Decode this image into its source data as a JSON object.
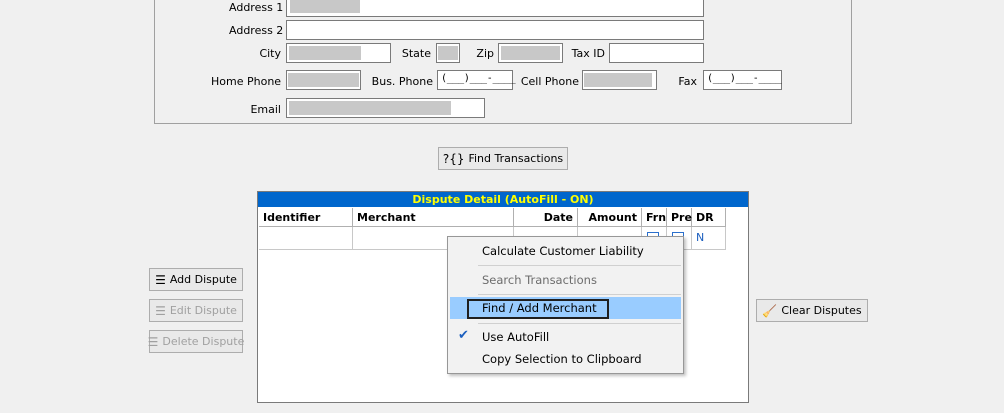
{
  "form": {
    "address1_label": "Address 1",
    "address2_label": "Address 2",
    "city_label": "City",
    "state_label": "State",
    "zip_label": "Zip",
    "taxid_label": "Tax ID",
    "homephone_label": "Home Phone",
    "busphone_label": "Bus. Phone",
    "busphone_value": "(___)___-____",
    "cellphone_label": "Cell Phone",
    "fax_label": "Fax",
    "fax_value": "(___)___-____",
    "email_label": "Email"
  },
  "find_transactions_button": "Find Transactions",
  "buttons": {
    "add_dispute": "Add Dispute",
    "edit_dispute": "Edit Dispute",
    "delete_dispute": "Delete Dispute",
    "clear_disputes": "Clear Disputes"
  },
  "grid": {
    "title": "Dispute Detail (AutoFill - ON)",
    "columns": [
      "Identifier",
      "Merchant",
      "Date",
      "Amount",
      "Frn",
      "Pre",
      "DR"
    ],
    "row": {
      "dr": "N"
    }
  },
  "context_menu": {
    "items": [
      {
        "label": "Calculate Customer Liability",
        "enabled": true
      },
      {
        "label": "Search Transactions",
        "enabled": false
      },
      {
        "label": "Find / Add Merchant",
        "enabled": true,
        "highlighted": true
      },
      {
        "label": "Use AutoFill",
        "enabled": true,
        "checked": true
      },
      {
        "label": "Copy Selection to Clipboard",
        "enabled": true
      }
    ]
  },
  "icons": {
    "find": "question-bracket-icon",
    "add": "add-rows-icon",
    "edit": "edit-rows-icon",
    "delete": "delete-rows-icon",
    "clear": "broom-icon",
    "check": "checkmark-icon"
  }
}
